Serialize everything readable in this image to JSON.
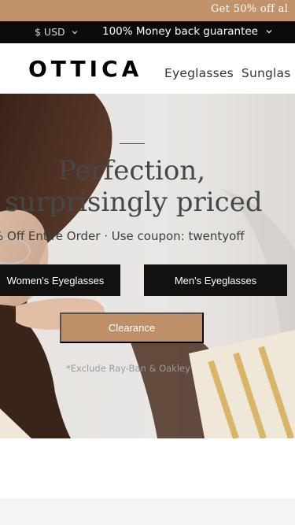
{
  "promo": {
    "text": "Get 50% off al"
  },
  "utility": {
    "currency": "$ USD",
    "guarantee": "100% Money back guarantee"
  },
  "header": {
    "logo": "OTTICA",
    "nav": [
      "Eyeglasses",
      "Sunglas"
    ]
  },
  "hero": {
    "title_line1": "Perfection,",
    "title_line2": "surprisingly priced",
    "subtitle": "% Off Entire Order · Use coupon: twentyoff",
    "buttons": {
      "women": "Women's Eyeglasses",
      "men": "Men's Eyeglasses",
      "clearance": "Clearance"
    },
    "note": "*Exclude Ray-Ban & Oakley"
  },
  "colors": {
    "promo_bg": "#c2926a",
    "utility_bg": "#0b0b0b",
    "accent": "#bf8f68",
    "button_dark": "#111111"
  },
  "icons": [
    "chevron-down-icon",
    "chevron-down-icon"
  ]
}
